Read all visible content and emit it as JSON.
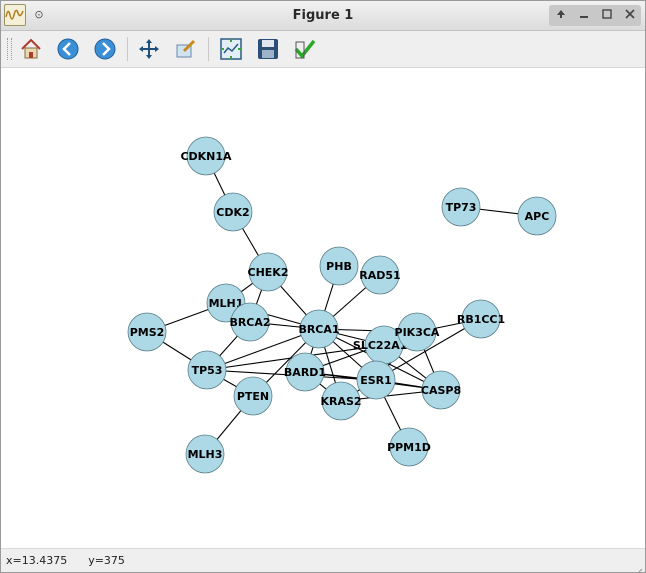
{
  "window": {
    "title": "Figure 1",
    "controls": [
      "up-arrow-icon",
      "minimize-icon",
      "maximize-icon",
      "close-icon"
    ]
  },
  "toolbar": {
    "buttons": [
      {
        "name": "home-button",
        "icon": "home-icon"
      },
      {
        "name": "back-button",
        "icon": "back-arrow-icon"
      },
      {
        "name": "forward-button",
        "icon": "forward-arrow-icon"
      },
      {
        "name": "pan-button",
        "icon": "pan-move-icon"
      },
      {
        "name": "zoom-button",
        "icon": "zoom-rect-icon"
      },
      {
        "name": "subplots-button",
        "icon": "subplots-config-icon"
      },
      {
        "name": "save-button",
        "icon": "save-floppy-icon"
      },
      {
        "name": "edit-axis-button",
        "icon": "checkmark-icon"
      }
    ]
  },
  "status": {
    "text": "x=13.4375      y=375"
  },
  "graph": {
    "node_color": "#add8e6",
    "node_stroke": "#5a7f8a",
    "edge_color": "#000000",
    "nodes": [
      "CDKN1A",
      "CDK2",
      "CHEK2",
      "PHB",
      "RAD51",
      "MLH1",
      "BRCA2",
      "PMS2",
      "BRCA1",
      "SLC22A18",
      "PIK3CA",
      "RB1CC1",
      "TP53",
      "BARD1",
      "ESR1",
      "CASP8",
      "PTEN",
      "KRAS2",
      "MLH3",
      "PPM1D",
      "TP73",
      "APC"
    ],
    "edges": [
      [
        "CDKN1A",
        "CDK2"
      ],
      [
        "CDK2",
        "CHEK2"
      ],
      [
        "CHEK2",
        "MLH1"
      ],
      [
        "CHEK2",
        "BRCA2"
      ],
      [
        "CHEK2",
        "BRCA1"
      ],
      [
        "PHB",
        "BRCA1"
      ],
      [
        "RAD51",
        "BRCA1"
      ],
      [
        "MLH1",
        "BRCA2"
      ],
      [
        "MLH1",
        "BRCA1"
      ],
      [
        "MLH1",
        "PMS2"
      ],
      [
        "BRCA2",
        "BRCA1"
      ],
      [
        "BRCA2",
        "TP53"
      ],
      [
        "PMS2",
        "TP53"
      ],
      [
        "TP53",
        "PTEN"
      ],
      [
        "TP53",
        "BRCA1"
      ],
      [
        "TP53",
        "SLC22A18"
      ],
      [
        "TP53",
        "ESR1"
      ],
      [
        "BRCA1",
        "SLC22A18"
      ],
      [
        "BRCA1",
        "PIK3CA"
      ],
      [
        "BRCA1",
        "BARD1"
      ],
      [
        "BRCA1",
        "ESR1"
      ],
      [
        "BRCA1",
        "KRAS2"
      ],
      [
        "BRCA1",
        "PTEN"
      ],
      [
        "BRCA1",
        "CASP8"
      ],
      [
        "SLC22A18",
        "PIK3CA"
      ],
      [
        "SLC22A18",
        "ESR1"
      ],
      [
        "SLC22A18",
        "CASP8"
      ],
      [
        "PIK3CA",
        "RB1CC1"
      ],
      [
        "PIK3CA",
        "CASP8"
      ],
      [
        "PIK3CA",
        "BARD1"
      ],
      [
        "PIK3CA",
        "ESR1"
      ],
      [
        "ESR1",
        "RB1CC1"
      ],
      [
        "ESR1",
        "KRAS2"
      ],
      [
        "ESR1",
        "CASP8"
      ],
      [
        "ESR1",
        "BARD1"
      ],
      [
        "ESR1",
        "PPM1D"
      ],
      [
        "BARD1",
        "KRAS2"
      ],
      [
        "BARD1",
        "CASP8"
      ],
      [
        "KRAS2",
        "CASP8"
      ],
      [
        "PTEN",
        "MLH3"
      ],
      [
        "TP73",
        "APC"
      ]
    ]
  }
}
